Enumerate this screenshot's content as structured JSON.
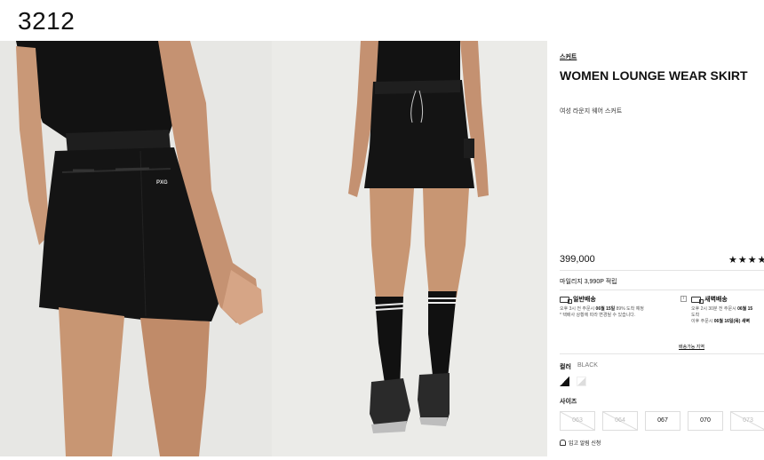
{
  "header": {
    "code": "3212"
  },
  "product": {
    "category": "스커트",
    "title": "WOMEN LOUNGE WEAR SKIRT",
    "subtitle": "여성 라운지 웨어 스커트",
    "price": "399,000",
    "rating": "★★★★",
    "points": "마일리지 3,990P 적립",
    "logo_text": "PXG"
  },
  "shipping": {
    "standard": {
      "title": "일반배송",
      "line1_prefix": "오후 3시 전 주문시 ",
      "line1_bold": "06월 15일",
      "line1_suffix": " 89% 도착 예정",
      "line2": "* 택배사 상황에 따라 변경될 수 있습니다."
    },
    "dawn": {
      "title": "새벽배송",
      "line1_prefix": "오후 2시 30분 전 주문시 ",
      "line1_bold": "06월 15",
      "line2": "도착",
      "line3_prefix": "이후 주문시 ",
      "line3_bold": "06월 16일(목) 새벽"
    },
    "region_link": "배송가능 지역",
    "info_icon": "i"
  },
  "options": {
    "color_label": "컬러",
    "color_value": "BLACK",
    "size_label": "사이즈",
    "sizes": [
      {
        "label": "063",
        "available": false
      },
      {
        "label": "064",
        "available": false
      },
      {
        "label": "067",
        "available": true
      },
      {
        "label": "070",
        "available": true
      },
      {
        "label": "073",
        "available": false
      }
    ]
  },
  "notify_label": "입고 알림 신청",
  "colors": {
    "skirt": "#141414",
    "skin": "#c99877",
    "background_back": "#e7e7e4",
    "background_front": "#ebebe8"
  }
}
